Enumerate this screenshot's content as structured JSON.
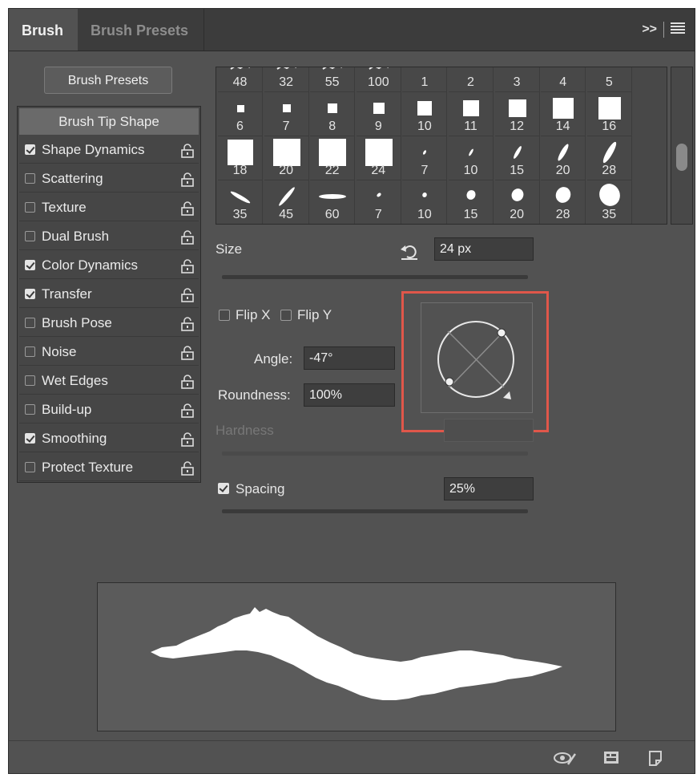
{
  "tabs": {
    "active": "Brush",
    "second": "Brush Presets"
  },
  "tab_icons": {
    "collapse": "double-chevron-right-icon",
    "menu": "hamburger-menu-icon"
  },
  "presets_button": "Brush Presets",
  "sidebar": {
    "header": "Brush Tip Shape",
    "items": [
      {
        "label": "Shape Dynamics",
        "checked": true
      },
      {
        "label": "Scattering",
        "checked": false
      },
      {
        "label": "Texture",
        "checked": false
      },
      {
        "label": "Dual Brush",
        "checked": false
      },
      {
        "label": "Color Dynamics",
        "checked": true
      },
      {
        "label": "Transfer",
        "checked": true
      },
      {
        "label": "Brush Pose",
        "checked": false
      },
      {
        "label": "Noise",
        "checked": false
      },
      {
        "label": "Wet Edges",
        "checked": false
      },
      {
        "label": "Build-up",
        "checked": false
      },
      {
        "label": "Smoothing",
        "checked": true
      },
      {
        "label": "Protect Texture",
        "checked": false
      }
    ],
    "lock_icon": "unlock-icon"
  },
  "brush_grid": {
    "rows": [
      [
        {
          "n": "48",
          "t": "splatter"
        },
        {
          "n": "32",
          "t": "splatter"
        },
        {
          "n": "55",
          "t": "splatter"
        },
        {
          "n": "100",
          "t": "splatter"
        },
        {
          "n": "1",
          "t": "none"
        },
        {
          "n": "2",
          "t": "none"
        },
        {
          "n": "3",
          "t": "none"
        },
        {
          "n": "4",
          "t": "none"
        },
        {
          "n": "5",
          "t": "none"
        }
      ],
      [
        {
          "n": "6",
          "t": "square",
          "s": 9
        },
        {
          "n": "7",
          "t": "square",
          "s": 10
        },
        {
          "n": "8",
          "t": "square",
          "s": 12
        },
        {
          "n": "9",
          "t": "square",
          "s": 14
        },
        {
          "n": "10",
          "t": "square",
          "s": 18
        },
        {
          "n": "11",
          "t": "square",
          "s": 20
        },
        {
          "n": "12",
          "t": "square",
          "s": 22
        },
        {
          "n": "14",
          "t": "square",
          "s": 26
        },
        {
          "n": "16",
          "t": "square",
          "s": 28
        }
      ],
      [
        {
          "n": "18",
          "t": "square",
          "s": 32
        },
        {
          "n": "20",
          "t": "square",
          "s": 34
        },
        {
          "n": "22",
          "t": "square",
          "s": 34
        },
        {
          "n": "24",
          "t": "square",
          "s": 34
        },
        {
          "n": "7",
          "t": "slash",
          "s": 6
        },
        {
          "n": "10",
          "t": "slash",
          "s": 10
        },
        {
          "n": "15",
          "t": "slash",
          "s": 18
        },
        {
          "n": "20",
          "t": "slash",
          "s": 24
        },
        {
          "n": "28",
          "t": "slash",
          "s": 30
        }
      ],
      [
        {
          "n": "35",
          "t": "diag"
        },
        {
          "n": "45",
          "t": "diag2"
        },
        {
          "n": "60",
          "t": "flat"
        },
        {
          "n": "7",
          "t": "dot"
        },
        {
          "n": "10",
          "t": "ellipse",
          "s": 6
        },
        {
          "n": "15",
          "t": "ellipse",
          "s": 12
        },
        {
          "n": "20",
          "t": "ellipse",
          "s": 16
        },
        {
          "n": "28",
          "t": "ellipse",
          "s": 20
        },
        {
          "n": "35",
          "t": "ellipse",
          "s": 28
        }
      ]
    ]
  },
  "size": {
    "label": "Size",
    "value": "24 px",
    "reset_icon": "reset-arrow-icon",
    "level": 0.11
  },
  "flip_x": {
    "label": "Flip X",
    "checked": false
  },
  "flip_y": {
    "label": "Flip Y",
    "checked": false
  },
  "angle": {
    "label": "Angle:",
    "value": "-47°"
  },
  "roundness": {
    "label": "Roundness:",
    "value": "100%"
  },
  "hardness": {
    "label": "Hardness",
    "value": ""
  },
  "spacing": {
    "label": "Spacing",
    "checked": true,
    "value": "25%",
    "level": 0.11
  },
  "bottom_icons": [
    "eye-brush-icon",
    "grid-panel-icon",
    "new-brush-icon"
  ],
  "colors": {
    "highlight": "#e0574a",
    "panel": "#525252"
  }
}
